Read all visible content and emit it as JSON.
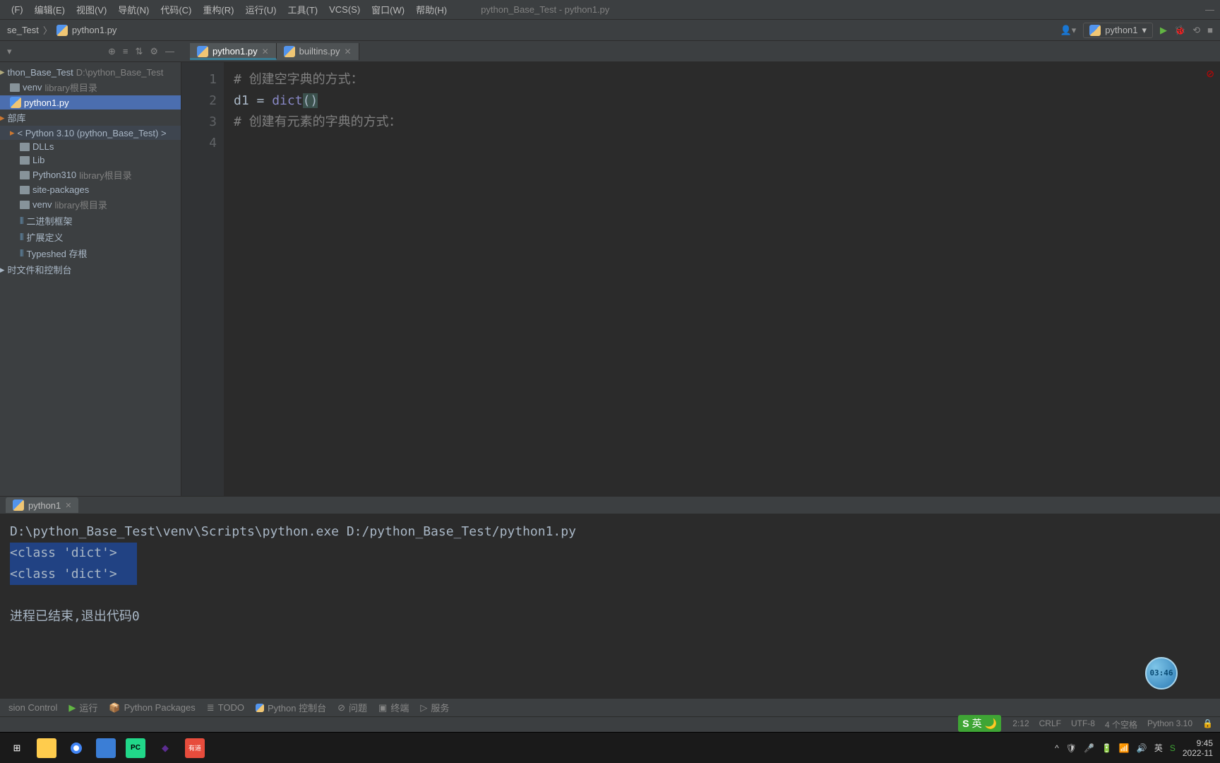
{
  "menubar": {
    "items": [
      {
        "label": "(F)",
        "accel": "F"
      },
      {
        "label": "编辑(E)",
        "accel": "E"
      },
      {
        "label": "视图(V)",
        "accel": "V"
      },
      {
        "label": "导航(N)",
        "accel": "N"
      },
      {
        "label": "代码(C)",
        "accel": "C"
      },
      {
        "label": "重构(R)",
        "accel": "R"
      },
      {
        "label": "运行(U)",
        "accel": "U"
      },
      {
        "label": "工具(T)",
        "accel": "T"
      },
      {
        "label": "VCS(S)",
        "accel": "S"
      },
      {
        "label": "窗口(W)",
        "accel": "W"
      },
      {
        "label": "帮助(H)",
        "accel": "H"
      }
    ],
    "window_title": "python_Base_Test - python1.py"
  },
  "breadcrumb": {
    "root": "se_Test",
    "file": "python1.py"
  },
  "run_config": {
    "label": "python1"
  },
  "sidebar_icons": [
    "target",
    "collapse",
    "expand",
    "gear",
    "minimize"
  ],
  "editor_tabs": [
    {
      "label": "python1.py",
      "closable": true,
      "active": true
    },
    {
      "label": "builtins.py",
      "closable": true,
      "active": false
    }
  ],
  "tree": [
    {
      "indent": 0,
      "icon": "project",
      "label": "thon_Base_Test",
      "dim": "D:\\python_Base_Test"
    },
    {
      "indent": 1,
      "icon": "folder",
      "label": "venv",
      "dim": "library根目录"
    },
    {
      "indent": 1,
      "icon": "py",
      "label": "python1.py",
      "sel": true
    },
    {
      "indent": 0,
      "icon": "lib",
      "label": "部库"
    },
    {
      "indent": 1,
      "icon": "lib",
      "label": "< Python 3.10 (python_Base_Test) >",
      "highlight": true
    },
    {
      "indent": 2,
      "icon": "folder",
      "label": "DLLs"
    },
    {
      "indent": 2,
      "icon": "folder",
      "label": "Lib"
    },
    {
      "indent": 2,
      "icon": "folder",
      "label": "Python310",
      "dim": "library根目录"
    },
    {
      "indent": 2,
      "icon": "folder",
      "label": "site-packages"
    },
    {
      "indent": 2,
      "icon": "folder",
      "label": "venv",
      "dim": "library根目录"
    },
    {
      "indent": 2,
      "icon": "stub",
      "label": "二进制框架"
    },
    {
      "indent": 2,
      "icon": "stub",
      "label": "扩展定义"
    },
    {
      "indent": 2,
      "icon": "stub",
      "label": "Typeshed 存根"
    },
    {
      "indent": 0,
      "icon": "temp",
      "label": "时文件和控制台"
    }
  ],
  "code": {
    "lines": [
      {
        "n": "1",
        "tokens": [
          {
            "t": "comment",
            "v": "# 创建空字典的方式："
          }
        ]
      },
      {
        "n": "2",
        "tokens": [
          {
            "t": "var",
            "v": "d1"
          },
          {
            "t": "op",
            "v": " = "
          },
          {
            "t": "builtin",
            "v": "dict"
          },
          {
            "t": "paren",
            "v": "("
          },
          {
            "t": "paren2",
            "v": ")"
          }
        ]
      },
      {
        "n": "3",
        "tokens": [
          {
            "t": "comment",
            "v": "# 创建有元素的字典的方式："
          }
        ]
      },
      {
        "n": "4",
        "tokens": []
      }
    ]
  },
  "console_tab": {
    "label": "python1"
  },
  "console": {
    "lines": [
      {
        "text": "D:\\python_Base_Test\\venv\\Scripts\\python.exe D:/python_Base_Test/python1.py",
        "sel": false
      },
      {
        "text": "<class 'dict'>",
        "sel": true
      },
      {
        "text": "<class 'dict'>",
        "sel": true
      },
      {
        "text": "",
        "sel": false
      },
      {
        "text": "进程已结束,退出代码0",
        "sel": false
      }
    ]
  },
  "timer": "03:46",
  "bottombar": {
    "items": [
      {
        "icon": "vcs",
        "label": "sion Control"
      },
      {
        "icon": "run",
        "label": "运行"
      },
      {
        "icon": "pkg",
        "label": "Python Packages"
      },
      {
        "icon": "todo",
        "label": "TODO"
      },
      {
        "icon": "console",
        "label": "Python 控制台"
      },
      {
        "icon": "problems",
        "label": "问题"
      },
      {
        "icon": "terminal",
        "label": "终端"
      },
      {
        "icon": "services",
        "label": "服务"
      }
    ]
  },
  "status": {
    "position": "2:12",
    "eol": "CRLF",
    "encoding": "UTF-8",
    "indent": "4 个空格",
    "interpreter": "Python 3.10"
  },
  "ime_badge": "英",
  "tray": {
    "ime": "英",
    "time": "9:45",
    "date": "2022-11"
  }
}
